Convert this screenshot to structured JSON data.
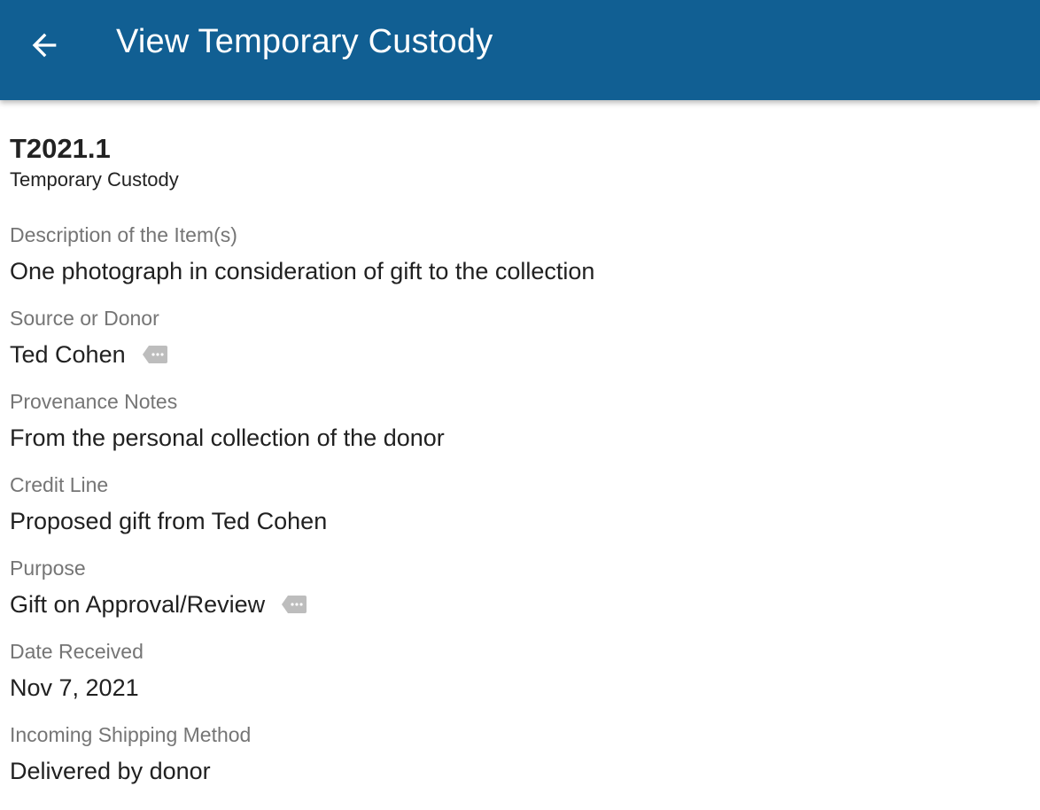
{
  "header": {
    "title": "View Temporary Custody",
    "back_icon": "arrow-left-icon",
    "background": "#115f93"
  },
  "record": {
    "id": "T2021.1",
    "type": "Temporary Custody"
  },
  "fields": [
    {
      "label": "Description of the Item(s)",
      "value": "One photograph in consideration of gift to the collection",
      "has_tag": false
    },
    {
      "label": "Source or Donor",
      "value": "Ted Cohen",
      "has_tag": true
    },
    {
      "label": "Provenance Notes",
      "value": "From the personal collection of the donor",
      "has_tag": false
    },
    {
      "label": "Credit Line",
      "value": "Proposed gift from Ted Cohen",
      "has_tag": false
    },
    {
      "label": "Purpose",
      "value": "Gift on Approval/Review",
      "has_tag": true
    },
    {
      "label": "Date Received",
      "value": "Nov 7, 2021",
      "has_tag": false
    },
    {
      "label": "Incoming Shipping Method",
      "value": "Delivered by donor",
      "has_tag": false
    }
  ],
  "tag_icon": "tag-more-icon"
}
